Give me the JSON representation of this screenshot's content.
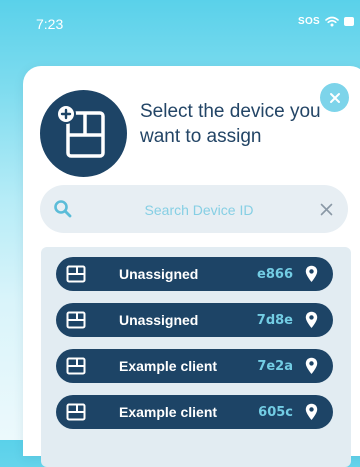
{
  "status_bar": {
    "time": "7:23",
    "sos": "SOS",
    "icons": [
      "wifi-icon",
      "battery-icon"
    ]
  },
  "dialog": {
    "title": "Select the device you want to assign",
    "illustration_icon": "add-device-icon",
    "close_icon": "close-icon"
  },
  "search": {
    "placeholder": "Search Device ID",
    "value": "",
    "search_icon": "search-icon",
    "clear_icon": "clear-icon"
  },
  "devices": [
    {
      "name": "Unassigned",
      "id": "e866",
      "icon": "device-icon",
      "action_icon": "location-pin-icon"
    },
    {
      "name": "Unassigned",
      "id": "7d8e",
      "icon": "device-icon",
      "action_icon": "location-pin-icon"
    },
    {
      "name": "Example client",
      "id": "7e2a",
      "icon": "device-icon",
      "action_icon": "location-pin-icon"
    },
    {
      "name": "Example client",
      "id": "605c",
      "icon": "device-icon",
      "action_icon": "location-pin-icon"
    }
  ],
  "colors": {
    "navy": "#1d4466",
    "accent": "#7dd4ea",
    "id_text": "#73cde4",
    "search_bg": "#e7eef3",
    "list_bg": "#e2ecf2"
  }
}
